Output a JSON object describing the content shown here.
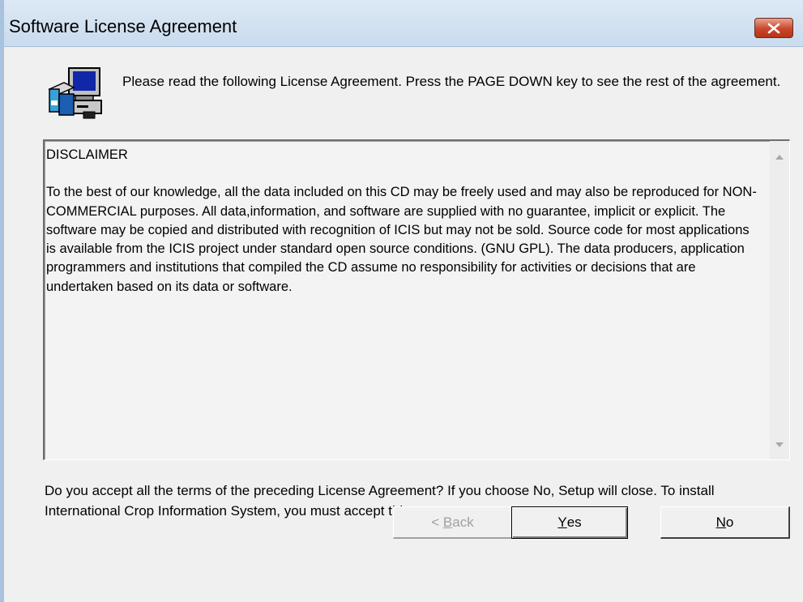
{
  "window": {
    "title": "Software License Agreement"
  },
  "intro": {
    "text": "Please read the following License Agreement.  Press the PAGE DOWN key to see the rest of the agreement."
  },
  "license": {
    "heading": "DISCLAIMER",
    "body": "To the best of our knowledge, all the data included on this CD may be freely used and may also be reproduced for NON-COMMERCIAL purposes.  All data,information, and software are supplied with no guarantee, implicit or explicit.  The software may be copied and distributed with recognition of ICIS but may not be sold.  Source code for most applications is available from the ICIS project under standard open source conditions. (GNU GPL).  The data producers, application programmers and institutions that compiled the CD assume no responsibility for activities or decisions that are undertaken based on its data or software."
  },
  "question": {
    "text": "Do you accept all the terms of the preceding License Agreement?  If you choose No,  Setup will close.  To install International Crop Information System, you must accept this agreement."
  },
  "buttons": {
    "back": {
      "prefix": "< ",
      "accel": "B",
      "rest": "ack",
      "enabled": false
    },
    "yes": {
      "accel": "Y",
      "rest": "es",
      "enabled": true,
      "default": true
    },
    "no": {
      "accel": "N",
      "rest": "o",
      "enabled": true
    }
  },
  "icons": {
    "close": "close-icon",
    "setup": "setup-computer-icon",
    "scroll_up": "scroll-up-arrow-icon",
    "scroll_down": "scroll-down-arrow-icon"
  },
  "colors": {
    "close_button": "#c9462c",
    "titlebar": "#c9dbee",
    "dialog_background": "#f0f0f0"
  }
}
